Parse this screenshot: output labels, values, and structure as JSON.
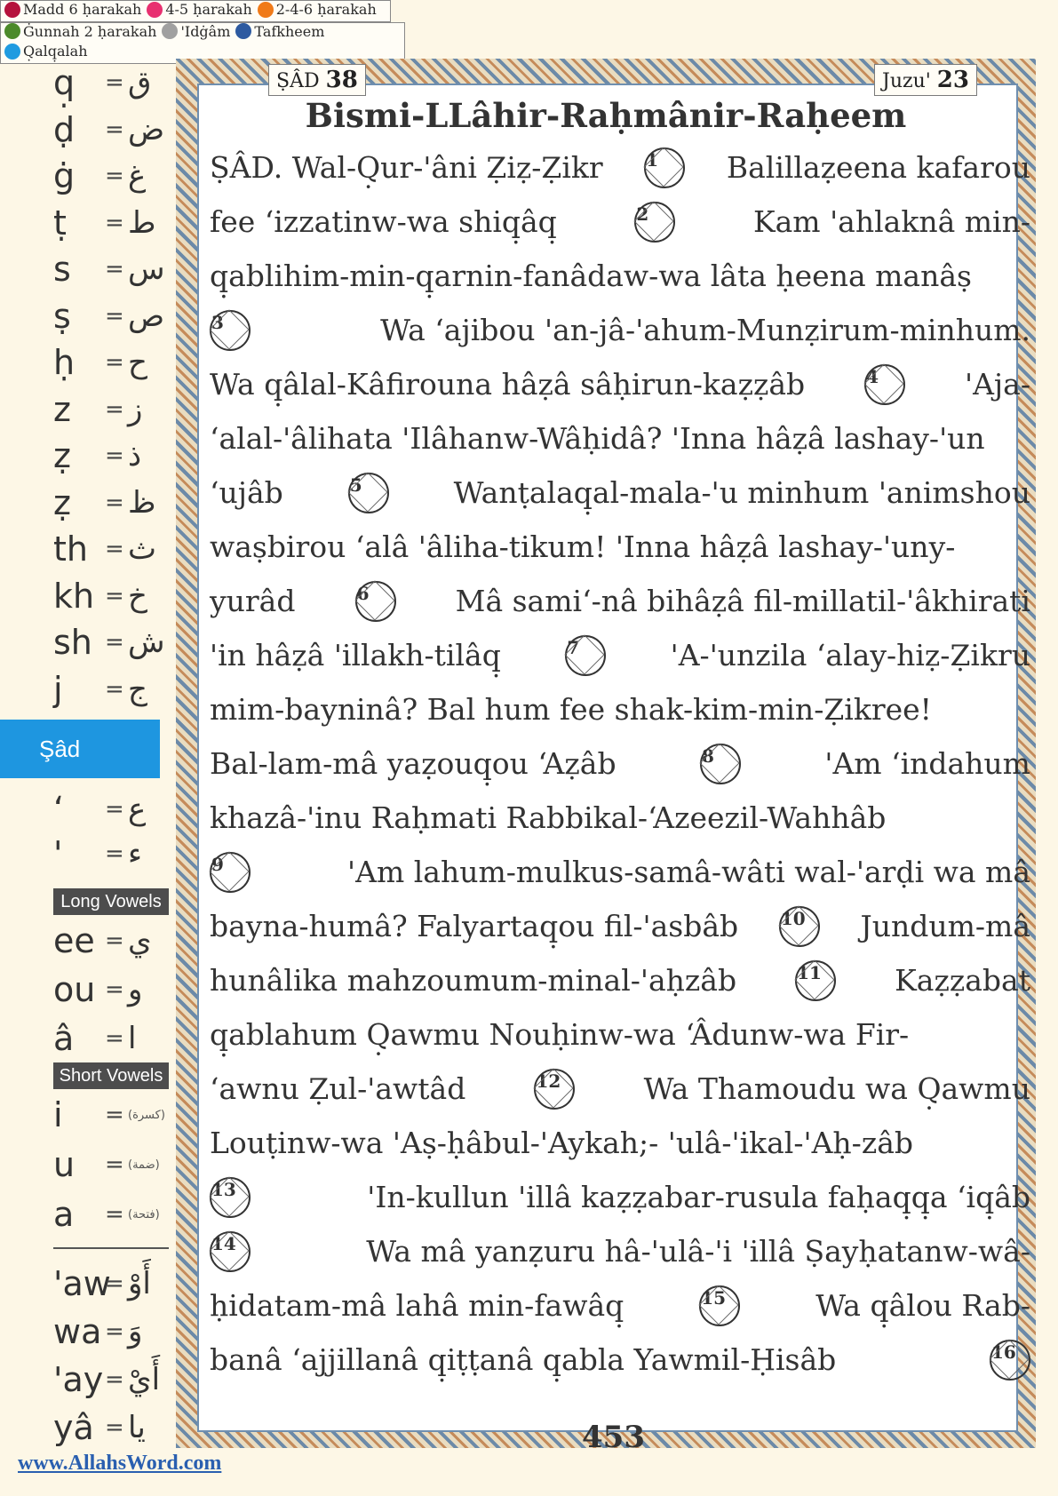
{
  "sidebar": {
    "consonants": [
      {
        "latin": "q̣",
        "arabic": "ق"
      },
      {
        "latin": "ḍ",
        "arabic": "ض"
      },
      {
        "latin": "ġ",
        "arabic": "غ"
      },
      {
        "latin": "ṭ",
        "arabic": "ط"
      },
      {
        "latin": "s",
        "arabic": "س"
      },
      {
        "latin": "ṣ",
        "arabic": "ص"
      },
      {
        "latin": "ḥ",
        "arabic": "ح"
      },
      {
        "latin": "z",
        "arabic": "ز"
      },
      {
        "latin": "ẓ",
        "arabic": "ذ"
      },
      {
        "latin": "ẓ",
        "arabic": "ظ"
      },
      {
        "latin": "th",
        "arabic": "ث"
      },
      {
        "latin": "kh",
        "arabic": "خ"
      },
      {
        "latin": "sh",
        "arabic": "ش"
      },
      {
        "latin": "j",
        "arabic": "ج"
      }
    ],
    "active_tab": "Şâd",
    "extra": [
      {
        "latin": "‘",
        "arabic": "ع"
      },
      {
        "latin": "'",
        "arabic": "ء"
      }
    ],
    "long_vowels_header": "Long Vowels",
    "long_vowels": [
      {
        "latin": "ee",
        "arabic": "ي"
      },
      {
        "latin": "ou",
        "arabic": "و"
      },
      {
        "latin": "â",
        "arabic": "ا"
      }
    ],
    "short_vowels_header": "Short Vowels",
    "short_vowels": [
      {
        "latin": "i",
        "arabic": "(كسرة)"
      },
      {
        "latin": "u",
        "arabic": "(ضمة)"
      },
      {
        "latin": "a",
        "arabic": "(فتحة)"
      }
    ],
    "diphthongs": [
      {
        "latin": "'aw",
        "arabic": "أَوْ"
      },
      {
        "latin": "wa",
        "arabic": "وَ"
      },
      {
        "latin": "'ay",
        "arabic": "أَيْ"
      },
      {
        "latin": "yâ",
        "arabic": "يا"
      }
    ],
    "equals": "=",
    "website": "www.AllahsWord.com"
  },
  "header": {
    "surah_name": "ṢÂD",
    "surah_number": "38",
    "juz_label": "Juzu'",
    "juz_number": "23"
  },
  "bismillah": "Bismi-LLâhir-Raḥmânir-Raḥeem",
  "lines": [
    [
      "ṢÂD. Wal-Q̣ur-'âni Ẓiẓ-Ẓikr",
      "#1",
      "Balillaẓeena kafarou"
    ],
    [
      "fee ‘izzatinw-wa shiq̣âq̣",
      "#2",
      "Kam 'ahlaknâ min-"
    ],
    [
      "q̣ablihim-min-q̣arnin-fanâdaw-wa lâta ḥeena manâṣ"
    ],
    [
      "#3",
      "Wa ‘ajibou 'an-jâ-'ahum-Munẓirum-minhum."
    ],
    [
      "Wa q̣âlal-Kâfirouna hâẓâ sâḥirun-kaẓẓâb",
      "#4",
      "'Aja-"
    ],
    [
      "‘alal-'âlihata 'Ilâhanw-Wâḥidâ? 'Inna hâẓâ lashay-'un"
    ],
    [
      "‘ujâb",
      "#5",
      "Wanṭalaq̣al-mala-'u minhum 'animshou"
    ],
    [
      "waṣbirou ‘alâ 'âliha-tikum! 'Inna hâẓâ lashay-'uny-"
    ],
    [
      "yurâd",
      "#6",
      "Mâ sami‘-nâ bihâẓâ fil-millatil-'âkhirati"
    ],
    [
      "'in hâẓâ 'illakh-tilâq̣",
      "#7",
      "'A-'unzila ‘alay-hiẓ-Ẓikru"
    ],
    [
      "mim-bayninâ? Bal hum fee shak-kim-min-Ẓikree!"
    ],
    [
      "Bal-lam-mâ yaẓouq̣ou ‘Aẓâb",
      "#8",
      "'Am ‘indahum"
    ],
    [
      "khazâ-'inu Raḥmati Rabbikal-‘Azeezil-Wahhâb"
    ],
    [
      "#9",
      "'Am lahum-mulkus-samâ-wâti wal-'arḍi wa mâ"
    ],
    [
      "bayna-humâ? Falyartaq̣ou fil-'asbâb",
      "#10",
      "Jundum-mâ"
    ],
    [
      "hunâlika mahzoumum-minal-'aḥzâb",
      "#11",
      "Kaẓẓabat"
    ],
    [
      "q̣ablahum Q̣awmu Nouḥinw-wa ‘Âdunw-wa Fir-"
    ],
    [
      "‘awnu Ẓul-'awtâd",
      "#12",
      "Wa Thamoudu wa Q̣awmu"
    ],
    [
      "Louṭinw-wa 'Aṣ-ḥâbul-'Aykah;- 'ulâ-'ikal-'Aḥ-zâb"
    ],
    [
      "#13",
      "'In-kullun 'illâ kaẓẓabar-rusula faḥaq̣q̣a ‘iq̣âb"
    ],
    [
      "#14",
      "Wa mâ yanẓuru hâ-'ulâ-'i 'illâ Ṣayḥatanw-wâ-"
    ],
    [
      "ḥidatam-mâ lahâ min-fawâq̣",
      "#15",
      "Wa q̣âlou Rab-"
    ],
    [
      "banâ ‘ajjillanâ q̣iṭṭanâ q̣abla Yawmil-Ḥisâb",
      "#16"
    ]
  ],
  "legend": [
    {
      "label": "Madd 6 ḥarakah",
      "color": "#b5123c"
    },
    {
      "label": "4-5 ḥarakah",
      "color": "#e8306f"
    },
    {
      "label": "2-4-6 ḥarakah",
      "color": "#f07a18"
    },
    {
      "label": "Ġunnah 2 ḥarakah",
      "color": "#4c8a2a"
    },
    {
      "label": "'Idġâm",
      "color": "#a0a0a0"
    },
    {
      "label": "Tafkheem",
      "color": "#2d5aa0"
    },
    {
      "label": "Q̣alq̣alah",
      "color": "#1f9be0"
    }
  ],
  "page_number": "453"
}
